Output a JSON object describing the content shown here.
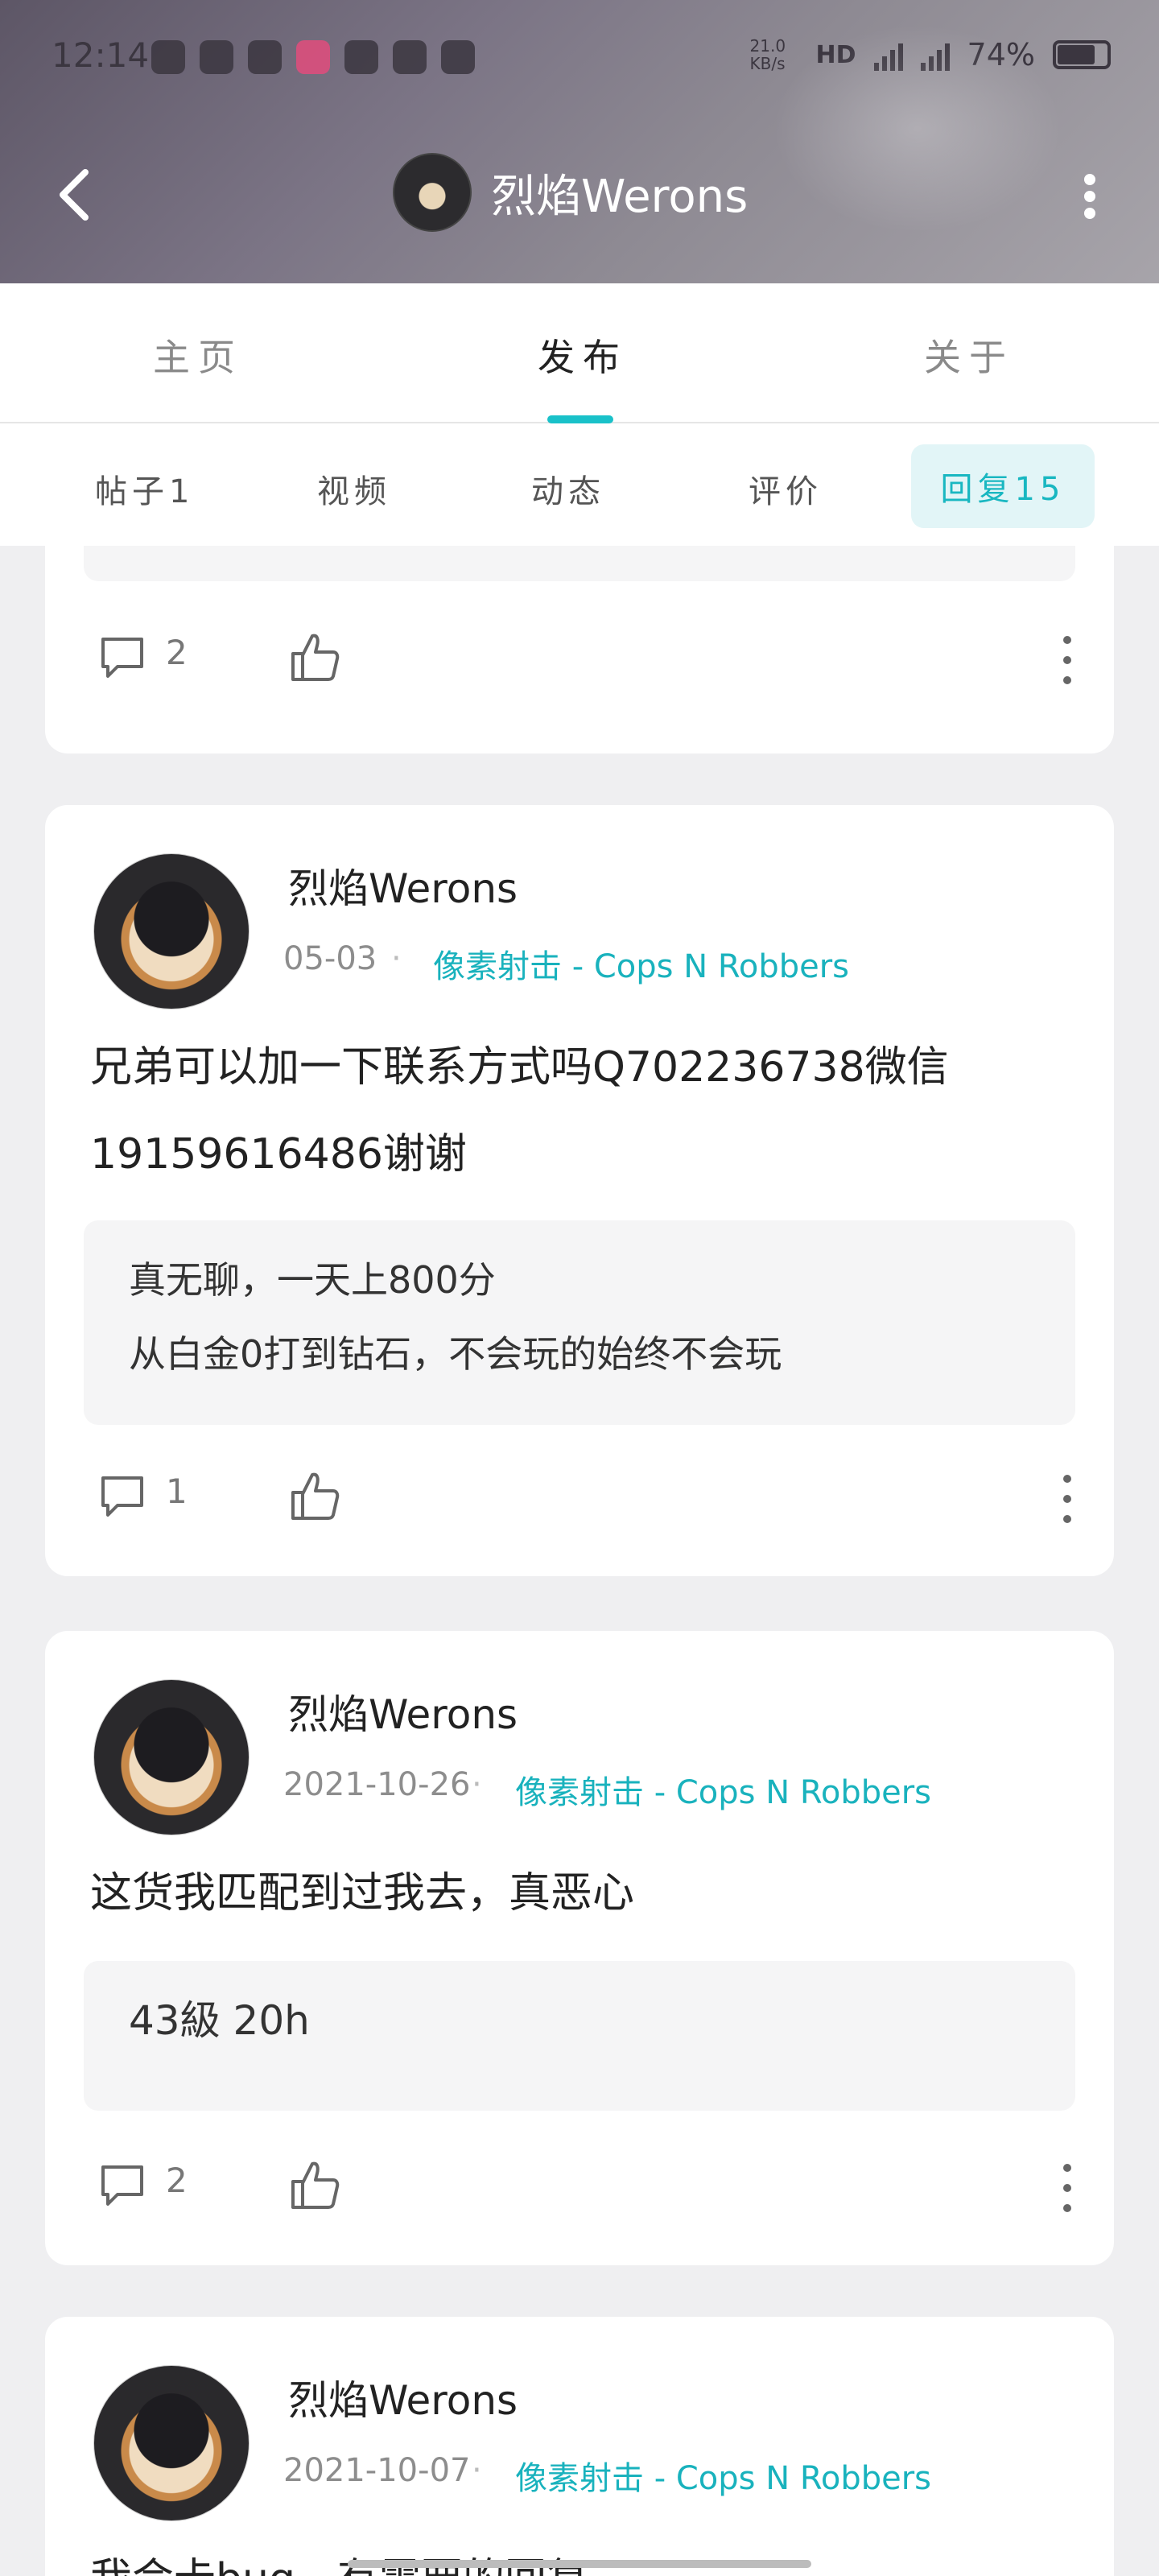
{
  "status_bar": {
    "time": "12:14",
    "net_speed": "21.0 KB/s",
    "battery_percent": "74%",
    "app_icons": [
      "qq-icon",
      "weibo-icon",
      "taptap-icon",
      "bilibili-icon",
      "browser-icon",
      "alipay-icon",
      "game-icon"
    ]
  },
  "header": {
    "title": "烈焰Werons"
  },
  "main_tabs": [
    {
      "label": "主页"
    },
    {
      "label": "发布"
    },
    {
      "label": "关于"
    }
  ],
  "sub_tabs": [
    {
      "label": "帖子1"
    },
    {
      "label": "视频"
    },
    {
      "label": "动态"
    },
    {
      "label": "评价"
    },
    {
      "label": "回复15"
    }
  ],
  "cards": [
    {
      "comment_count": "2"
    },
    {
      "author": "烈焰Werons",
      "date": "05-03",
      "dot": "·",
      "game": "像素射击 - Cops N Robbers",
      "text_line1": "兄弟可以加一下联系方式吗Q702236738微信",
      "text_line2": "19159616486谢谢",
      "quote_line1": "真无聊，一天上800分",
      "quote_line2": "从白金0打到钻石，不会玩的始终不会玩",
      "comment_count": "1"
    },
    {
      "author": "烈焰Werons",
      "date": "2021-10-26",
      "dot": "·",
      "game": "像素射击 - Cops N Robbers",
      "text_line1": "这货我匹配到过我去，真恶心",
      "quote_line1": "43級 20h",
      "comment_count": "2"
    },
    {
      "author": "烈焰Werons",
      "date": "2021-10-07",
      "dot": "·",
      "game": "像素射击 - Cops N Robbers",
      "text_line1": "我会卡bug，有需要的回复"
    }
  ],
  "colors": {
    "accent": "#19b7c1",
    "background": "#efeff1"
  }
}
